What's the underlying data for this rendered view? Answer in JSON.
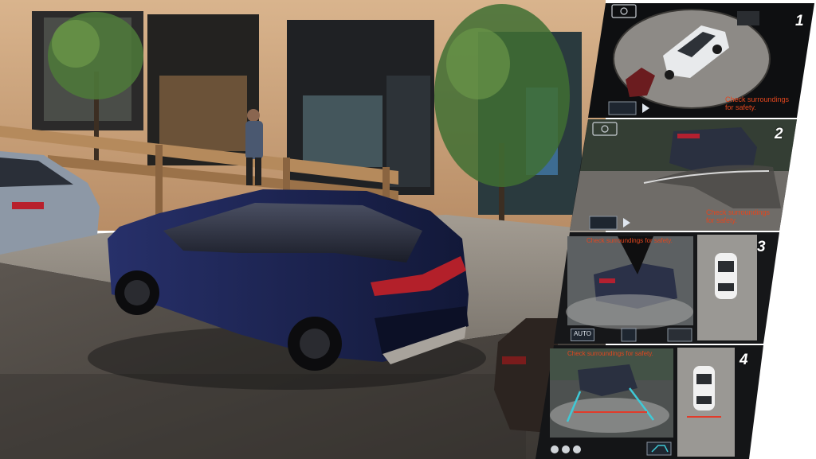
{
  "panels": [
    {
      "number": "1",
      "warning_line1": "Check surroundings",
      "warning_line2": "for safety."
    },
    {
      "number": "2",
      "warning_line1": "Check surroundings",
      "warning_line2": "for safety."
    },
    {
      "number": "3",
      "warning": "Check surroundings for safety.",
      "auto_label": "AUTO"
    },
    {
      "number": "4",
      "warning": "Check surroundings for safety."
    }
  ],
  "colors": {
    "warning_text": "#e2461e",
    "vehicle_body": "#1c2456",
    "guide_lines": "#3fc9d6",
    "distance_line": "#e23b2a",
    "storefront": "#cfa57e"
  },
  "icons": [
    "camera-view-icon",
    "play-icon",
    "camera-switch-icon",
    "car-top-icon",
    "bird-eye-icon"
  ]
}
